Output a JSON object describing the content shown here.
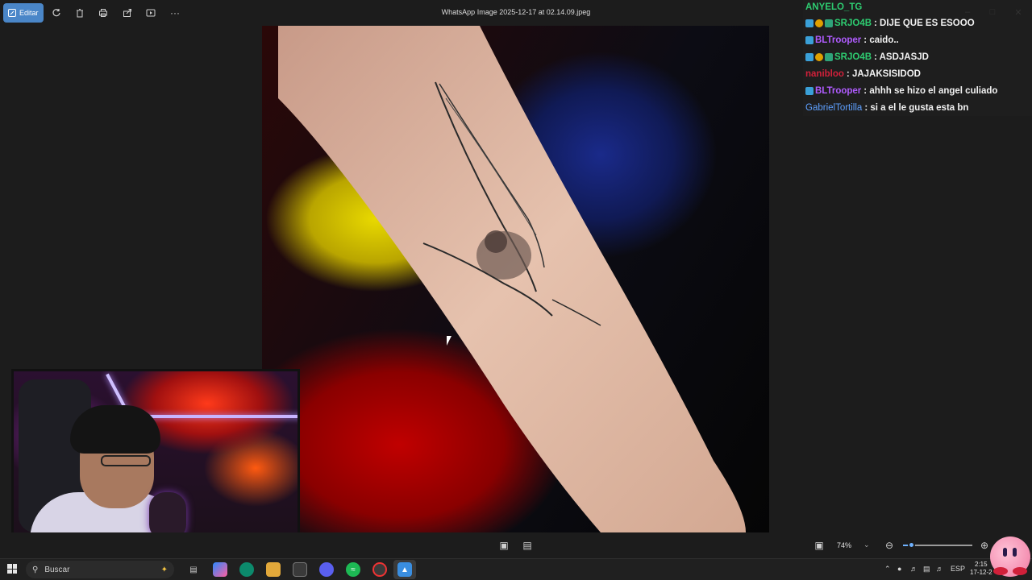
{
  "toolbar": {
    "edit_label": "Editar",
    "file_title": "WhatsApp Image 2025-12-17 at 02.14.09.jpeg",
    "more": "···",
    "icons": [
      "rotate-icon",
      "delete-icon",
      "print-icon",
      "share-icon",
      "slideshow-icon",
      "more-icon"
    ]
  },
  "chat": {
    "top_partial": {
      "user": "ANYELO_TG",
      "msg": ""
    },
    "lines": [
      {
        "user": "SRJO4B",
        "msg": ": DIJE QUE ES ESOOO",
        "color": "#2ecc71",
        "badges": [
          "blue",
          "gold",
          "green"
        ]
      },
      {
        "user": "BLTrooper",
        "msg": ": caido..",
        "color": "#b05cff",
        "badges": [
          "blue"
        ]
      },
      {
        "user": "SRJO4B",
        "msg": ": ASDJASJD",
        "color": "#2ecc71",
        "badges": [
          "blue",
          "gold",
          "green"
        ]
      },
      {
        "user": "nanibloo",
        "msg": ": JAJAKSISIDOD",
        "color": "#d0203a",
        "badges": []
      },
      {
        "user": "BLTrooper",
        "msg": ": ahhh se hizo el angel culiado",
        "color": "#b05cff",
        "badges": [
          "blue"
        ]
      },
      {
        "user": "GabrielTortilla",
        "msg": ": si a el le gusta esta bn",
        "color": "#5ea0ff",
        "badges": []
      }
    ]
  },
  "viewer": {
    "zoom": "74%",
    "zoom_level": 0.12
  },
  "taskbar": {
    "search_placeholder": "Buscar",
    "language": "ESP",
    "time": "2:15",
    "date": "17-12-2"
  }
}
